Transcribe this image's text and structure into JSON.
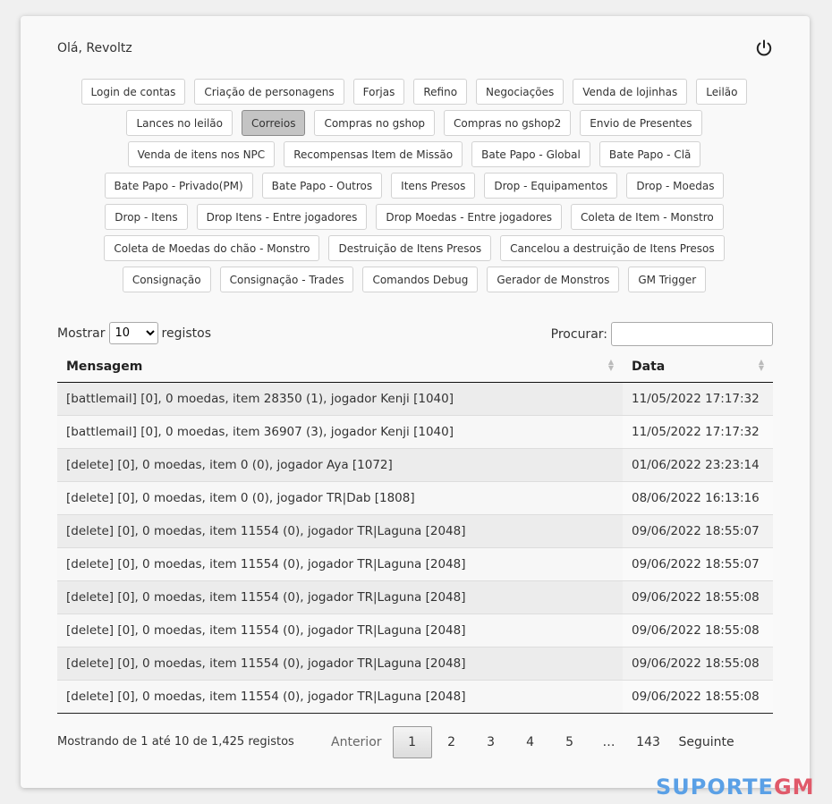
{
  "header": {
    "greeting": "Olá, Revoltz",
    "power_icon": "power-icon"
  },
  "filters": [
    {
      "label": "Login de contas",
      "active": false
    },
    {
      "label": "Criação de personagens",
      "active": false
    },
    {
      "label": "Forjas",
      "active": false
    },
    {
      "label": "Refino",
      "active": false
    },
    {
      "label": "Negociações",
      "active": false
    },
    {
      "label": "Venda de lojinhas",
      "active": false
    },
    {
      "label": "Leilão",
      "active": false
    },
    {
      "label": "Lances no leilão",
      "active": false
    },
    {
      "label": "Correios",
      "active": true
    },
    {
      "label": "Compras no gshop",
      "active": false
    },
    {
      "label": "Compras no gshop2",
      "active": false
    },
    {
      "label": "Envio de Presentes",
      "active": false
    },
    {
      "label": "Venda de itens nos NPC",
      "active": false
    },
    {
      "label": "Recompensas Item de Missão",
      "active": false
    },
    {
      "label": "Bate Papo - Global",
      "active": false
    },
    {
      "label": "Bate Papo - Clã",
      "active": false
    },
    {
      "label": "Bate Papo - Privado(PM)",
      "active": false
    },
    {
      "label": "Bate Papo - Outros",
      "active": false
    },
    {
      "label": "Itens Presos",
      "active": false
    },
    {
      "label": "Drop - Equipamentos",
      "active": false
    },
    {
      "label": "Drop - Moedas",
      "active": false
    },
    {
      "label": "Drop - Itens",
      "active": false
    },
    {
      "label": "Drop Itens - Entre jogadores",
      "active": false
    },
    {
      "label": "Drop Moedas - Entre jogadores",
      "active": false
    },
    {
      "label": "Coleta de Item - Monstro",
      "active": false
    },
    {
      "label": "Coleta de Moedas do chão - Monstro",
      "active": false
    },
    {
      "label": "Destruição de Itens Presos",
      "active": false
    },
    {
      "label": "Cancelou a destruição de Itens Presos",
      "active": false
    },
    {
      "label": "Consignação",
      "active": false
    },
    {
      "label": "Consignação - Trades",
      "active": false
    },
    {
      "label": "Comandos Debug",
      "active": false
    },
    {
      "label": "Gerador de Monstros",
      "active": false
    },
    {
      "label": "GM Trigger",
      "active": false
    }
  ],
  "length": {
    "prefix": "Mostrar",
    "value": "10",
    "suffix": "registos"
  },
  "search": {
    "label": "Procurar:",
    "value": ""
  },
  "table": {
    "headers": [
      "Mensagem",
      "Data"
    ],
    "rows": [
      {
        "msg": "[battlemail] [0], 0 moedas, item 28350 (1), jogador Kenji [1040]",
        "date": "11/05/2022 17:17:32"
      },
      {
        "msg": "[battlemail] [0], 0 moedas, item 36907 (3), jogador Kenji [1040]",
        "date": "11/05/2022 17:17:32"
      },
      {
        "msg": "[delete] [0], 0 moedas, item 0 (0), jogador Aya [1072]",
        "date": "01/06/2022 23:23:14"
      },
      {
        "msg": "[delete] [0], 0 moedas, item 0 (0), jogador TR|Dab [1808]",
        "date": "08/06/2022 16:13:16"
      },
      {
        "msg": "[delete] [0], 0 moedas, item 11554 (0), jogador TR|Laguna [2048]",
        "date": "09/06/2022 18:55:07"
      },
      {
        "msg": "[delete] [0], 0 moedas, item 11554 (0), jogador TR|Laguna [2048]",
        "date": "09/06/2022 18:55:07"
      },
      {
        "msg": "[delete] [0], 0 moedas, item 11554 (0), jogador TR|Laguna [2048]",
        "date": "09/06/2022 18:55:08"
      },
      {
        "msg": "[delete] [0], 0 moedas, item 11554 (0), jogador TR|Laguna [2048]",
        "date": "09/06/2022 18:55:08"
      },
      {
        "msg": "[delete] [0], 0 moedas, item 11554 (0), jogador TR|Laguna [2048]",
        "date": "09/06/2022 18:55:08"
      },
      {
        "msg": "[delete] [0], 0 moedas, item 11554 (0), jogador TR|Laguna [2048]",
        "date": "09/06/2022 18:55:08"
      }
    ]
  },
  "footer": {
    "info": "Mostrando de 1 até 10 de 1,425 registos",
    "prev": "Anterior",
    "pages": [
      "1",
      "2",
      "3",
      "4",
      "5",
      "…",
      "143"
    ],
    "current": "1",
    "next": "Seguinte"
  },
  "watermark": {
    "part1": "SUPORTE",
    "part2": "GM"
  }
}
